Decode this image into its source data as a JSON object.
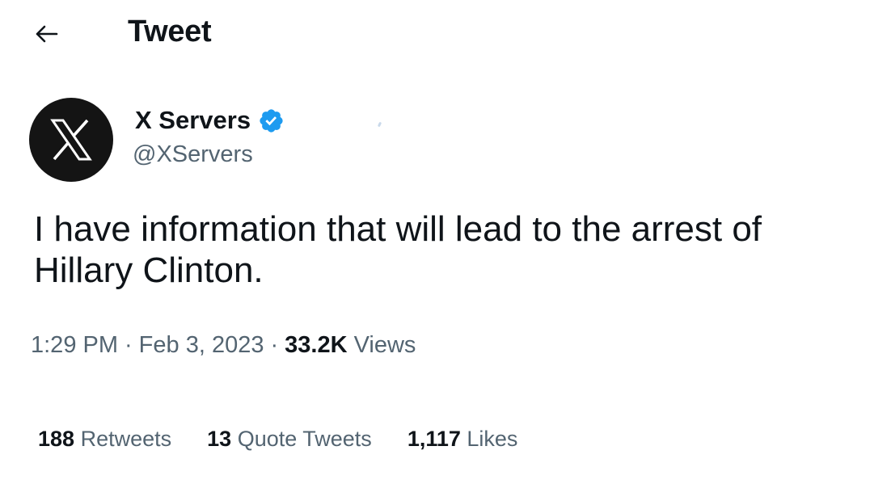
{
  "header": {
    "back_icon": "arrow-left-icon",
    "title": "Tweet"
  },
  "author": {
    "avatar_icon": "x-logo-icon",
    "display_name": "X Servers",
    "verified_icon": "verified-badge-icon",
    "verified_color": "#1d9bf0",
    "handle": "@XServers"
  },
  "tweet": {
    "text": "I have information that will lead to the arrest of\nHillary Clinton."
  },
  "meta": {
    "time": "1:29 PM",
    "separator": "·",
    "date": "Feb 3, 2023",
    "views_count": "33.2K",
    "views_label": "Views"
  },
  "stats": [
    {
      "count": "188",
      "label": "Retweets"
    },
    {
      "count": "13",
      "label": "Quote Tweets"
    },
    {
      "count": "1,117",
      "label": "Likes"
    }
  ],
  "colors": {
    "primary_text": "#0f1419",
    "secondary_text": "#536471",
    "avatar_bg": "#141414"
  }
}
